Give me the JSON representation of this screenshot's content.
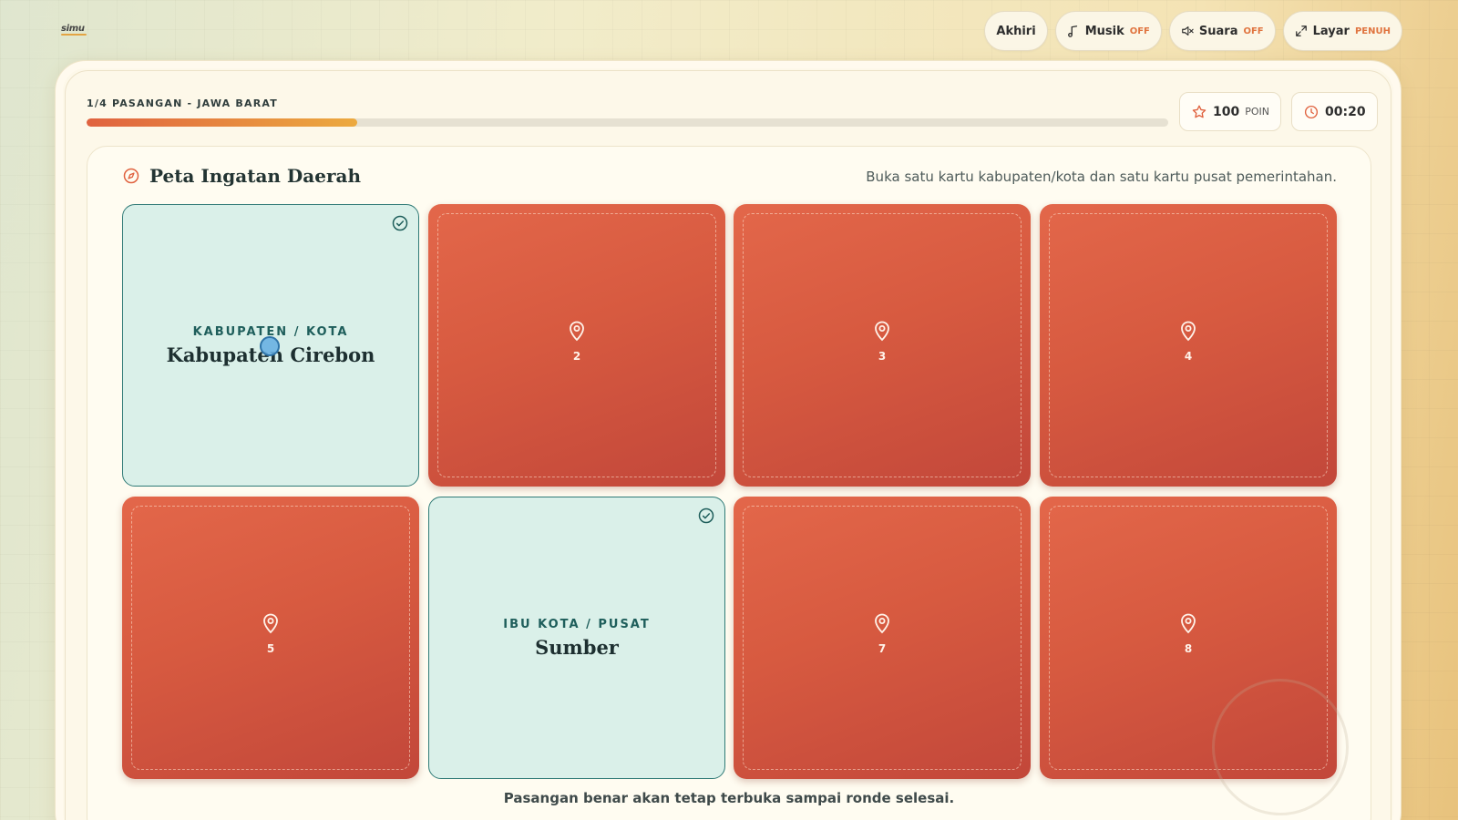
{
  "brand": {
    "logo_text": "simu"
  },
  "toolbar": {
    "end_label": "Akhiri",
    "music_label": "Musik",
    "music_state": "OFF",
    "sound_label": "Suara",
    "sound_state": "OFF",
    "screen_label": "Layar",
    "screen_state": "PENUH"
  },
  "progress": {
    "label": "1/4 PASANGAN - JAWA BARAT",
    "fraction": 0.25
  },
  "stats": {
    "points_value": "100",
    "points_unit": "POIN",
    "timer": "00:20"
  },
  "board": {
    "title": "Peta Ingatan Daerah",
    "hint": "Buka satu kartu kabupaten/kota dan satu kartu pusat pemerintahan.",
    "footer": "Pasangan benar akan tetap terbuka sampai ronde selesai."
  },
  "cards": [
    {
      "state": "open",
      "kind": "KABUPATEN / KOTA",
      "name": "Kabupaten Cirebon"
    },
    {
      "state": "closed",
      "number": "2"
    },
    {
      "state": "closed",
      "number": "3"
    },
    {
      "state": "closed",
      "number": "4"
    },
    {
      "state": "closed",
      "number": "5"
    },
    {
      "state": "open",
      "kind": "IBU KOTA / PUSAT",
      "name": "Sumber"
    },
    {
      "state": "closed",
      "number": "7"
    },
    {
      "state": "closed",
      "number": "8"
    }
  ],
  "colors": {
    "accent_orange": "#e0623f",
    "accent_amber": "#ecaa3f",
    "card_closed": "#d75a40",
    "card_open_bg": "#daf0e9",
    "card_open_border": "#2f7a76"
  }
}
